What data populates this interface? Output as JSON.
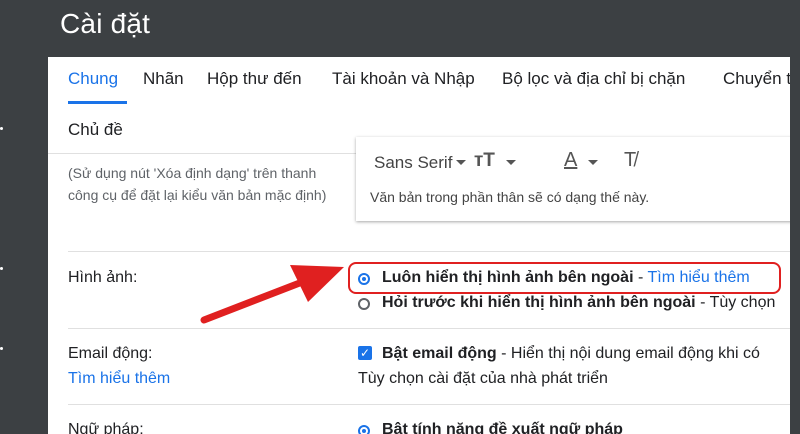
{
  "page": {
    "title": "Cài đặt"
  },
  "tabs": [
    "Chung",
    "Nhãn",
    "Hộp thư đến",
    "Tài khoản và Nhập",
    "Bộ lọc và địa chỉ bị chặn",
    "Chuyển t"
  ],
  "tab_row2": "Chủ đề",
  "default_text_style": {
    "hint": "(Sử dụng nút 'Xóa định dạng' trên thanh công cụ để đặt lại kiểu văn bản mặc định)",
    "font_name": "Sans Serif",
    "size_icon": "text-size-icon",
    "color_icon": "text-color-icon",
    "clear_icon": "clear-formatting-icon",
    "sample_text": "Văn bản trong phần thân sẽ có dạng thế này."
  },
  "images": {
    "label": "Hình ảnh:",
    "options": [
      {
        "label": "Luôn hiển thị hình ảnh bên ngoài",
        "separator": " - ",
        "link": "Tìm hiểu thêm",
        "checked": true
      },
      {
        "label": "Hỏi trước khi hiển thị hình ảnh bên ngoài",
        "separator": " - ",
        "description": "Tùy chọn",
        "checked": false
      }
    ]
  },
  "dynamic_email": {
    "label": "Email động:",
    "learn_more": "Tìm hiểu thêm",
    "option_label": "Bật email động",
    "option_desc": " - Hiển thị nội dung email động khi có",
    "dev_link": "Tùy chọn cài đặt của nhà phát triển",
    "checked": true
  },
  "grammar": {
    "label": "Ngữ pháp:",
    "option_label": "Bật tính năng đề xuất ngữ pháp"
  },
  "colors": {
    "accent": "#1a73e8",
    "header_bg": "#3c4043",
    "annotation": "#e02020"
  }
}
